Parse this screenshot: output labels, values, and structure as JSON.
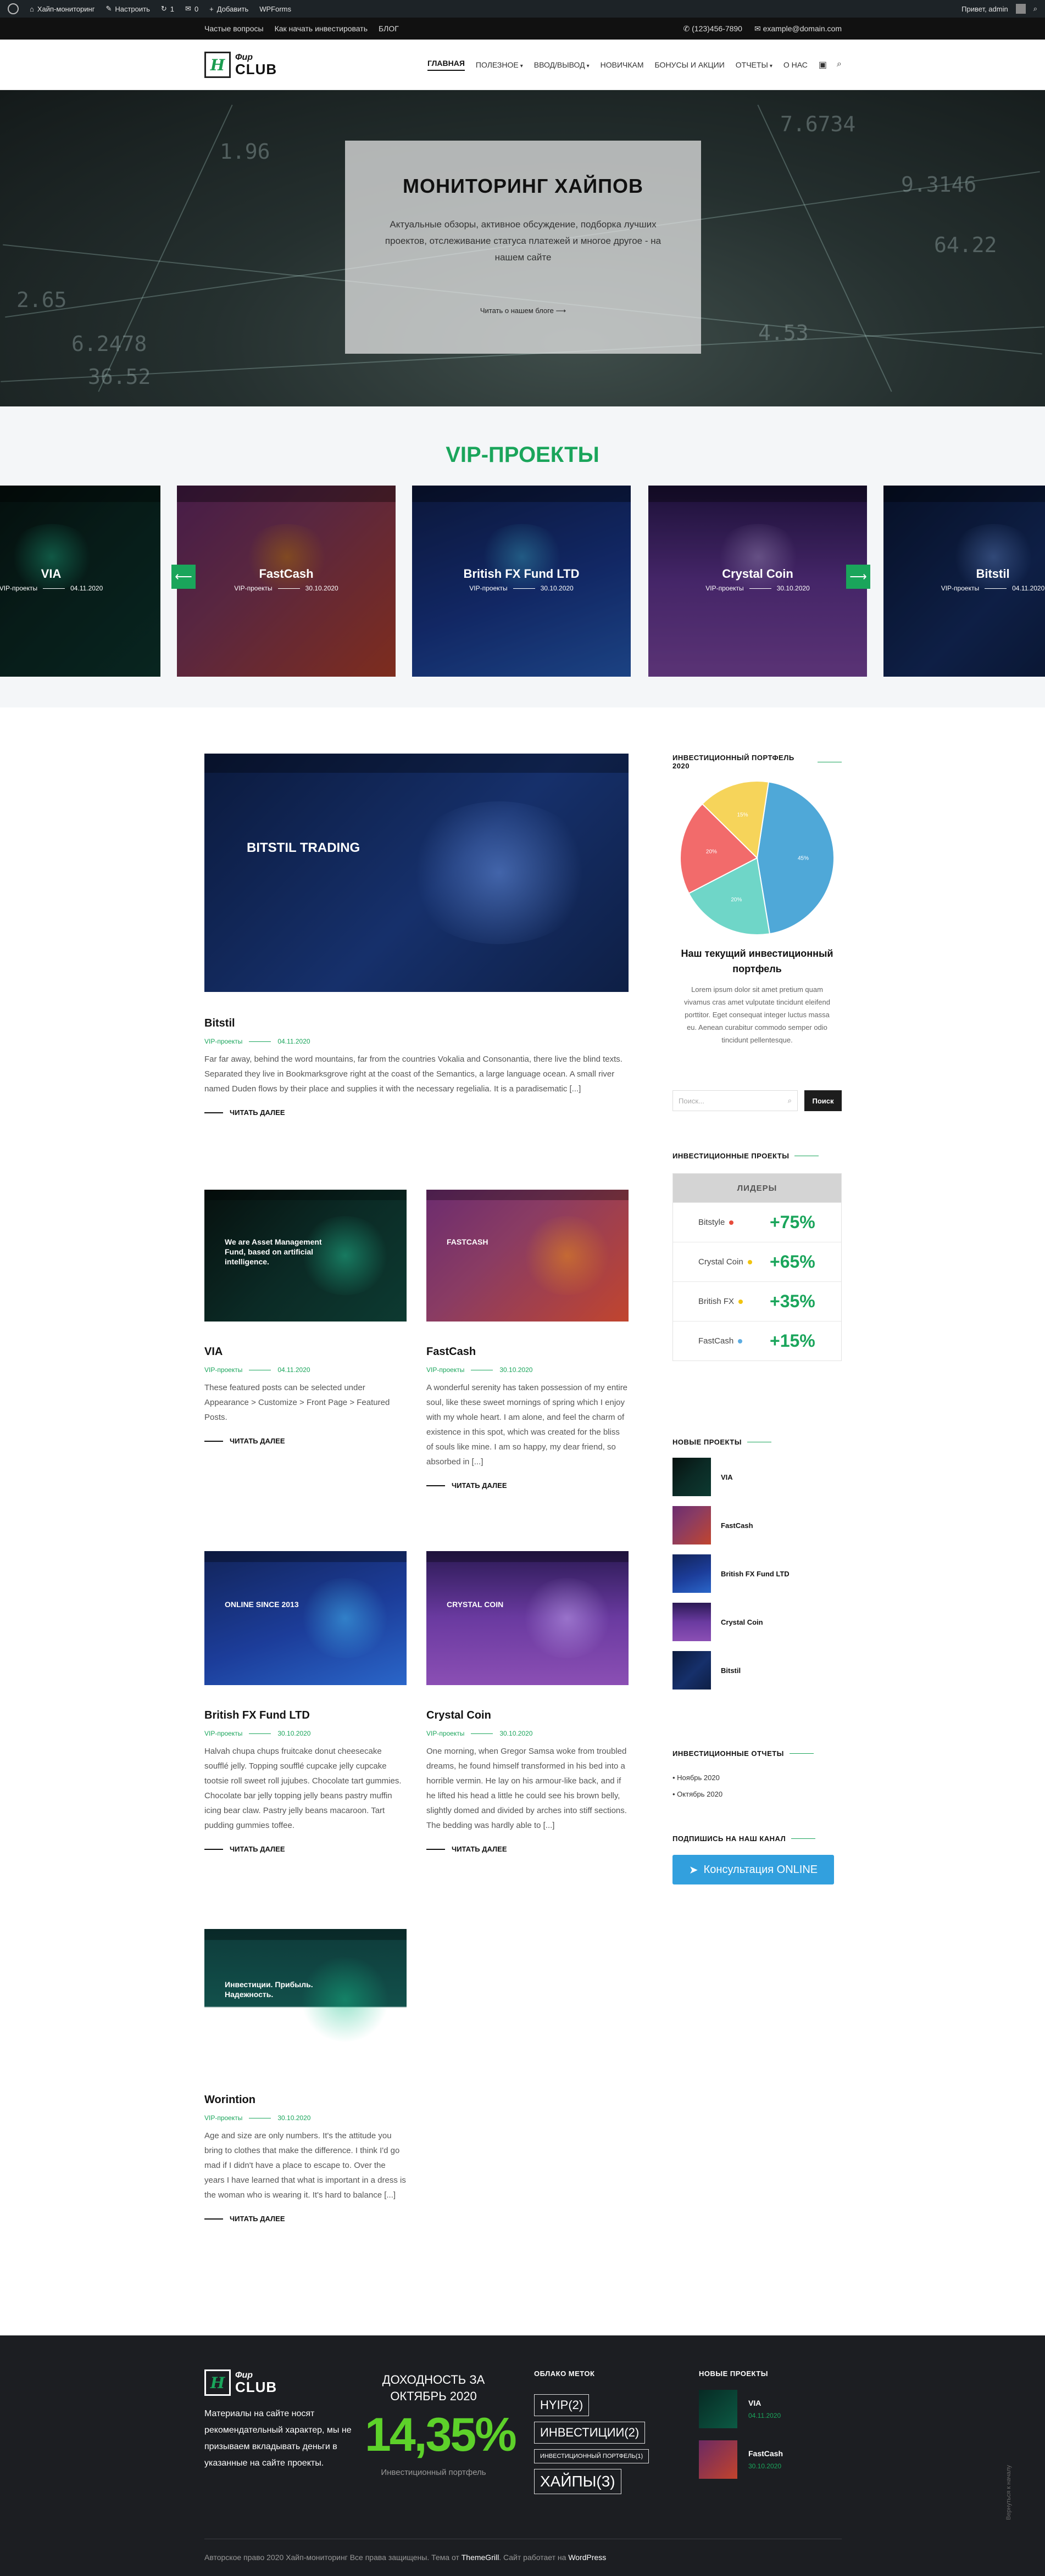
{
  "adminbar": {
    "site": "Хайп-мониторинг",
    "customize": "Настроить",
    "updates": "1",
    "comments": "0",
    "new": "Добавить",
    "wpforms": "WPForms",
    "greeting": "Привет, admin"
  },
  "topbar": {
    "links": [
      "Частые вопросы",
      "Как начать инвестировать",
      "БЛОГ"
    ],
    "phone": "(123)456-7890",
    "email": "example@domain.com"
  },
  "header": {
    "logo_mark": "Н",
    "logo_line1": "Фир",
    "logo_line2": "CLUB",
    "nav": [
      {
        "label": "ГЛАВНАЯ",
        "dropdown": false,
        "active": true
      },
      {
        "label": "ПОЛЕЗНОЕ",
        "dropdown": true,
        "active": false
      },
      {
        "label": "ВВОД/ВЫВОД",
        "dropdown": true,
        "active": false
      },
      {
        "label": "НОВИЧКАМ",
        "dropdown": false,
        "active": false
      },
      {
        "label": "БОНУСЫ И АКЦИИ",
        "dropdown": false,
        "active": false
      },
      {
        "label": "ОТЧЕТЫ",
        "dropdown": true,
        "active": false
      },
      {
        "label": "О НАС",
        "dropdown": false,
        "active": false
      }
    ]
  },
  "hero": {
    "title": "МОНИТОРИНГ ХАЙПОВ",
    "subtitle": "Актуальные обзоры, активное обсуждение, подборка лучших проектов, отслеживание статуса платежей и многое другое - на нашем сайте",
    "link": "Читать о нашем блоге",
    "bg_numbers": [
      "2.65",
      "6.2478",
      "36.52",
      "7.6734",
      "9.3146",
      "64.22",
      "1.96",
      "4.53"
    ]
  },
  "vip": {
    "title": "VIP-ПРОЕКТЫ",
    "cards": [
      {
        "name": "VIA",
        "category": "VIP-проекты",
        "date": "04.11.2020",
        "theme": "via"
      },
      {
        "name": "FastCash",
        "category": "VIP-проекты",
        "date": "30.10.2020",
        "theme": "fastcash"
      },
      {
        "name": "British FX Fund LTD",
        "category": "VIP-проекты",
        "date": "30.10.2020",
        "theme": "britishfx"
      },
      {
        "name": "Crystal Coin",
        "category": "VIP-проекты",
        "date": "30.10.2020",
        "theme": "crystal"
      },
      {
        "name": "Bitstil",
        "category": "VIP-проекты",
        "date": "04.11.2020",
        "theme": "bitstil"
      }
    ]
  },
  "posts": [
    {
      "id": "bitstil",
      "title": "Bitstil",
      "category": "VIP-проекты",
      "date": "04.11.2020",
      "excerpt": "Far far away, behind the word mountains, far from the countries Vokalia and Consonantia, there live the blind texts. Separated they live in Bookmarksgrove right at the coast of the Semantics, a large language ocean. A small river named Duden flows by their place and supplies it with the necessary regelialia. It is a paradisematic [...]",
      "read_more": "ЧИТАТЬ ДАЛЕЕ"
    },
    {
      "id": "via",
      "title": "VIA",
      "category": "VIP-проекты",
      "date": "04.11.2020",
      "excerpt": "These featured posts can be selected under Appearance > Customize > Front Page > Featured Posts.",
      "read_more": "ЧИТАТЬ ДАЛЕЕ"
    },
    {
      "id": "fastcash",
      "title": "FastCash",
      "category": "VIP-проекты",
      "date": "30.10.2020",
      "excerpt": "A wonderful serenity has taken possession of my entire soul, like these sweet mornings of spring which I enjoy with my whole heart. I am alone, and feel the charm of existence in this spot, which was created for the bliss of souls like mine. I am so happy, my dear friend, so absorbed in [...]",
      "read_more": "ЧИТАТЬ ДАЛЕЕ"
    },
    {
      "id": "britishfx",
      "title": "British FX Fund LTD",
      "category": "VIP-проекты",
      "date": "30.10.2020",
      "excerpt": "Halvah chupa chups fruitcake donut cheesecake soufflé jelly. Topping soufflé cupcake jelly cupcake tootsie roll sweet roll jujubes. Chocolate tart gummies. Chocolate bar jelly topping jelly beans pastry muffin icing bear claw. Pastry jelly beans macaroon. Tart pudding gummies toffee.",
      "read_more": "ЧИТАТЬ ДАЛЕЕ"
    },
    {
      "id": "crystal",
      "title": "Crystal Coin",
      "category": "VIP-проекты",
      "date": "30.10.2020",
      "excerpt": "One morning, when Gregor Samsa woke from troubled dreams, he found himself transformed in his bed into a horrible vermin. He lay on his armour-like back, and if he lifted his head a little he could see his brown belly, slightly domed and divided by arches into stiff sections. The bedding was hardly able to [...]",
      "read_more": "ЧИТАТЬ ДАЛЕЕ"
    },
    {
      "id": "worintion",
      "title": "Worintion",
      "category": "VIP-проекты",
      "date": "30.10.2020",
      "excerpt": "Age and size are only numbers. It's the attitude you bring to clothes that make the difference. I think I'd go mad if I didn't have a place to escape to. Over the years I have learned that what is important in a dress is the woman who is wearing it. It's hard to balance [...]",
      "read_more": "ЧИТАТЬ ДАЛЕЕ"
    }
  ],
  "thumbs": {
    "bitstil_heading": "BITSTIL TRADING",
    "via_line": "We are Asset Management Fund, based on artificial intelligence.",
    "fastcash_heading": "FASTCASH",
    "britishfx_heading": "ONLINE SINCE 2013",
    "crystal_heading": "CRYSTAL COIN",
    "worintion_heading": "Инвестиции. Прибыль. Надежность."
  },
  "sidebar": {
    "portfolio_title": "ИНВЕСТИЦИОННЫЙ ПОРТФЕЛЬ 2020",
    "portfolio_heading": "Наш текущий инвестиционный портфель",
    "portfolio_text": "Lorem ipsum dolor sit amet pretium quam vivamus cras amet vulputate tincidunt eleifend porttitor. Eget consequat integer luctus massa eu. Aenean curabitur commodo semper odio tincidunt pellentesque.",
    "search_placeholder": "Поиск...",
    "search_button": "Поиск",
    "leaders_title": "ИНВЕСТИЦИОННЫЕ ПРОЕКТЫ",
    "leaders_head": "ЛИДЕРЫ",
    "leaders": [
      {
        "name": "Bitstyle",
        "value": "+75%",
        "dot": "#e74c3c"
      },
      {
        "name": "Crystal Coin",
        "value": "+65%",
        "dot": "#f1c40f"
      },
      {
        "name": "British FX",
        "value": "+35%",
        "dot": "#f1c40f"
      },
      {
        "name": "FastCash",
        "value": "+15%",
        "dot": "#5dade2"
      }
    ],
    "new_projects_title": "НОВЫЕ ПРОЕКТЫ",
    "new_projects": [
      "VIA",
      "FastCash",
      "British FX Fund LTD",
      "Crystal Coin",
      "Bitstil"
    ],
    "reports_title": "ИНВЕСТИЦИОННЫЕ ОТЧЕТЫ",
    "reports": [
      "Ноябрь 2020",
      "Октябрь 2020"
    ],
    "channel_title": "ПОДПИШИСЬ НА НАШ КАНАЛ",
    "channel_button": "Консультация ONLINE"
  },
  "chart_data": {
    "type": "pie",
    "values": [
      45,
      20,
      20,
      15
    ],
    "colors": [
      "#4fa8d8",
      "#6fd6c8",
      "#f26b6b",
      "#f6d45a"
    ]
  },
  "footer": {
    "logo_line1": "Фир",
    "logo_line2": "CLUB",
    "disclaimer": "Материалы на сайте носят рекомендательный характер, мы не призываем вкладывать деньги в указанные на сайте проекты.",
    "yield_title": "ДОХОДНОСТЬ ЗА ОКТЯБРЬ 2020",
    "yield_value": "14,35%",
    "yield_caption": "Инвестиционный портфель",
    "tags_title": "ОБЛАКО МЕТОК",
    "tags": [
      "HYIP(2)",
      "ИНВЕСТИЦИИ(2)",
      "ИНВЕСТИЦИОННЫЙ ПОРТФЕЛЬ(1)",
      "ХАЙПЫ(3)"
    ],
    "new_title": "НОВЫЕ ПРОЕКТЫ",
    "new_items": [
      {
        "name": "VIA",
        "date": "04.11.2020"
      },
      {
        "name": "FastCash",
        "date": "30.10.2020"
      }
    ],
    "copyright_pre": "Авторское право 2020 Хайп-мониторинг Все права защищены. Тема от",
    "copyright_theme": "ThemeGrill",
    "copyright_mid": ". Сайт работает на",
    "copyright_wp": "WordPress",
    "back_to_top": "Вернуться к началу"
  }
}
